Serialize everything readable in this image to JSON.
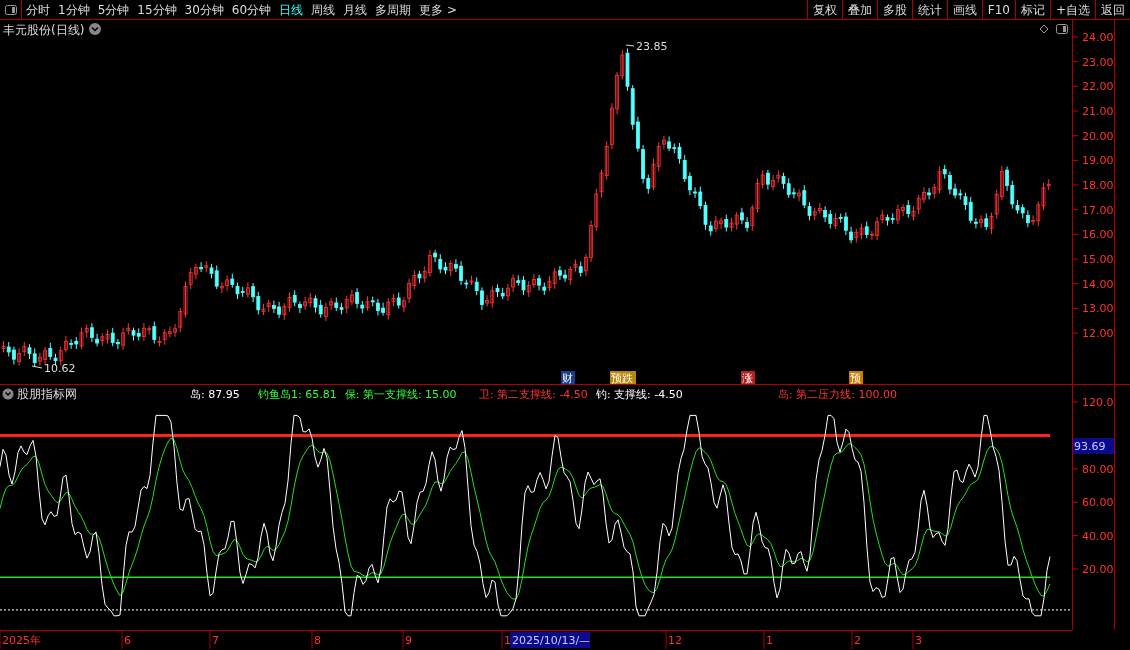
{
  "toolbar": {
    "periods": [
      {
        "label": "分时",
        "selected": false
      },
      {
        "label": "1分钟",
        "selected": false
      },
      {
        "label": "5分钟",
        "selected": false
      },
      {
        "label": "15分钟",
        "selected": false
      },
      {
        "label": "30分钟",
        "selected": false
      },
      {
        "label": "60分钟",
        "selected": false
      },
      {
        "label": "日线",
        "selected": true
      },
      {
        "label": "周线",
        "selected": false
      },
      {
        "label": "月线",
        "selected": false
      },
      {
        "label": "多周期",
        "selected": false
      },
      {
        "label": "更多 >",
        "selected": false
      }
    ],
    "actions": [
      "复权",
      "叠加",
      "多股",
      "统计",
      "画线",
      "F10",
      "标记",
      "+自选",
      "返回"
    ]
  },
  "main_chart": {
    "title": "丰元股份(日线)",
    "price_axis": [
      "24.00",
      "23.00",
      "22.00",
      "21.00",
      "20.00",
      "19.00",
      "18.00",
      "17.00",
      "16.00",
      "15.00",
      "14.00",
      "13.00",
      "12.00"
    ],
    "high_label": "23.85",
    "low_label": "10.62",
    "events": [
      {
        "label": "财",
        "color": "#1a3d8f"
      },
      {
        "label": "预跌",
        "color": "#b8860b"
      },
      {
        "label": "涨",
        "color": "#b22222"
      },
      {
        "label": "预",
        "color": "#c87a00"
      }
    ]
  },
  "indicator": {
    "title": "股朋指标网",
    "legend": [
      {
        "text": "岛: 87.95",
        "color": "#ffffff"
      },
      {
        "text": "钓鱼岛1: 65.81",
        "color": "#33ff33"
      },
      {
        "text": "保: 第一支撑线: 15.00",
        "color": "#33ff33"
      },
      {
        "text": "卫: 第二支撑线: -4.50",
        "color": "#ff3333"
      },
      {
        "text": "钓: 支撑线: -4.50",
        "color": "#ffffff"
      },
      {
        "text": "岛: 第二压力线: 100.00",
        "color": "#ff3333"
      }
    ],
    "axis": [
      "120.0",
      "80.00",
      "60.00",
      "40.00",
      "20.00"
    ],
    "cursor_value": "93.69"
  },
  "date_axis": {
    "labels": [
      "2025年",
      "6",
      "7",
      "8",
      "9",
      "1",
      "12",
      "1",
      "2",
      "3"
    ],
    "cursor_date": "2025/10/13/—"
  }
}
